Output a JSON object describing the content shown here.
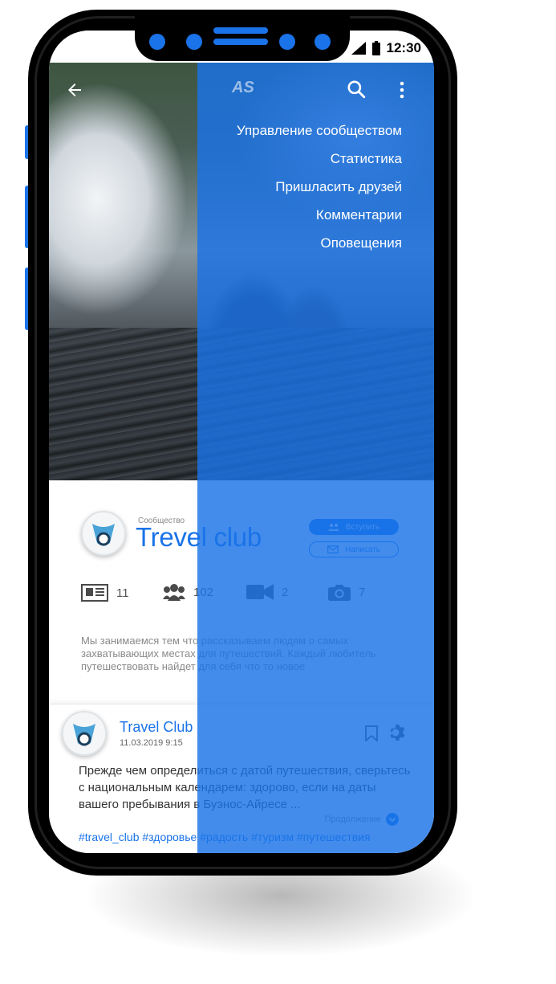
{
  "status_bar": {
    "time": "12:30"
  },
  "header": {
    "logo": "AS",
    "icons": [
      "back-arrow-icon",
      "search-icon",
      "more-vert-icon"
    ]
  },
  "menu": {
    "items": [
      "Управление сообществом",
      "Статистика",
      "Пришласить друзей",
      "Комментарии",
      "Оповещения"
    ]
  },
  "group": {
    "caption": "Сообщество",
    "title": "Trevel club",
    "join_label": "Вступить",
    "message_label": "Написать",
    "stats": [
      {
        "icon": "news-icon",
        "count": "11"
      },
      {
        "icon": "members-icon",
        "count": "102"
      },
      {
        "icon": "video-icon",
        "count": "2"
      },
      {
        "icon": "camera-icon",
        "count": "7"
      }
    ],
    "description": "Мы занимаемся тем что рассказываем людям о самых захватывающих местах для путешествий. Каждый любитель путешествовать найдет для себя что то новое"
  },
  "post": {
    "author": "Travel Club",
    "date": "11.03.2019  9:15",
    "text": "Прежде чем определиться с датой путешествия, сверьтесь с национальным календарем: здорово, если на даты вашего пребывания в Буэнос-Айресе ...",
    "read_more": "Продолжение",
    "tags": "#travel_club #здоровье #радость #туризм #путешествия"
  },
  "colors": {
    "accent": "#1a73e8",
    "overlay": "#1a73e8",
    "frame": "#000000"
  }
}
